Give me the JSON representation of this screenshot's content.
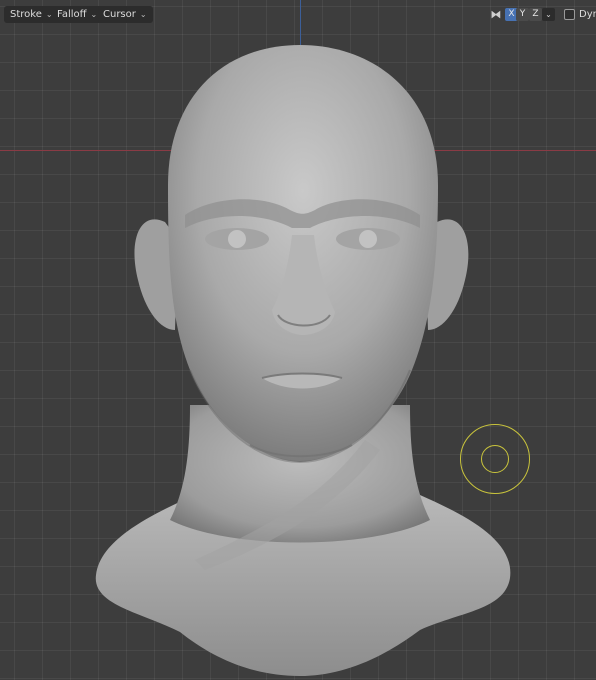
{
  "toolbar": {
    "stroke_label": "Stroke",
    "falloff_label": "Falloff",
    "cursor_label": "Cursor",
    "mirror_x": "X",
    "mirror_y": "Y",
    "mirror_z": "Z",
    "dyntopo_label": "Dyn"
  },
  "icons": {
    "dropdown": "chevron-down-icon",
    "symmetry": "butterfly-icon",
    "checkbox": "checkbox-icon"
  },
  "colors": {
    "active_axis": "#4772b3",
    "x_axis_line": "#8a3b45",
    "y_axis_line": "#3c5f99",
    "brush_cursor": "#c9c43c"
  }
}
